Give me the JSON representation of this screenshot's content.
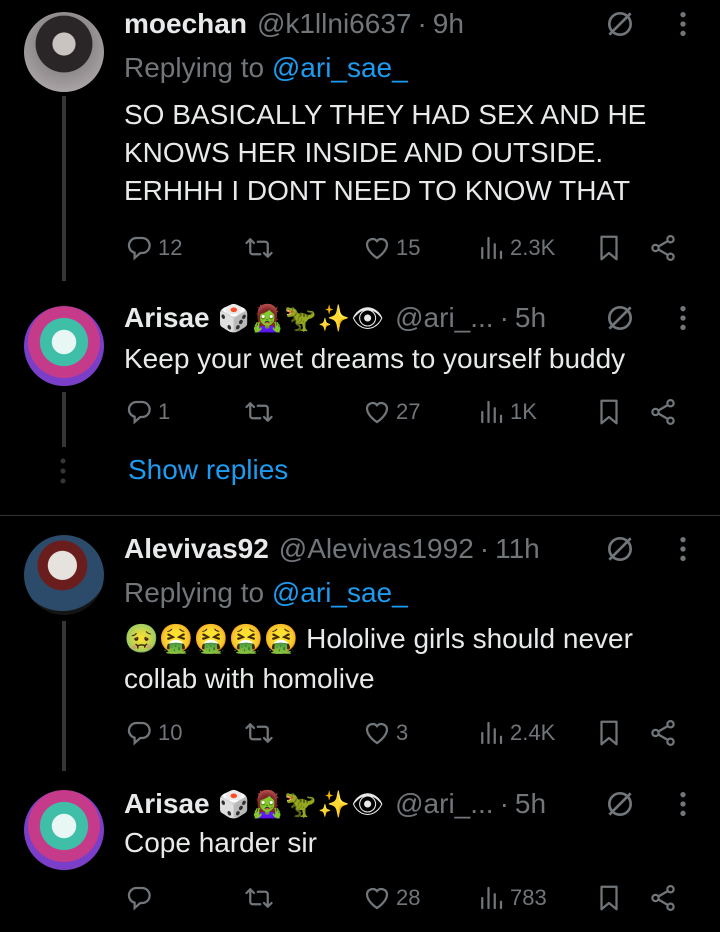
{
  "tweets": [
    {
      "name": "moechan",
      "emojis": "",
      "handle": "@k1llni6637",
      "time": "9h",
      "replying_prefix": "Replying to ",
      "replying_handle": "@ari_sae_",
      "text": "SO BASICALLY THEY HAD SEX AND HE KNOWS HER INSIDE AND OUTSIDE. ERHHH I DONT NEED TO KNOW THAT",
      "replies": "12",
      "retweets": "",
      "likes": "15",
      "views": "2.3K"
    },
    {
      "name": "Arisae",
      "emojis": "🎲🧟‍♀️🦖✨👁",
      "handle": "@ari_...",
      "time": "5h",
      "text": "Keep your wet dreams to yourself buddy",
      "replies": "1",
      "retweets": "",
      "likes": "27",
      "views": "1K"
    },
    {
      "name": "Alevivas92",
      "emojis": "",
      "handle": "@Alevivas1992",
      "time": "11h",
      "replying_prefix": "Replying to ",
      "replying_handle": "@ari_sae_",
      "text": "🤢🤮🤮🤮🤮 Hololive girls should never collab with homolive",
      "replies": "10",
      "retweets": "",
      "likes": "3",
      "views": "2.4K"
    },
    {
      "name": "Arisae",
      "emojis": "🎲🧟‍♀️🦖✨👁",
      "handle": "@ari_...",
      "time": "5h",
      "text": "Cope harder sir",
      "replies": "",
      "retweets": "",
      "likes": "28",
      "views": "783"
    }
  ],
  "show_replies": "Show replies",
  "colors": {
    "accent": "#1d9bf0",
    "muted": "#71767b",
    "text": "#e7e9ea",
    "bg": "#000000"
  },
  "icons": [
    "reply-icon",
    "retweet-icon",
    "like-icon",
    "views-icon",
    "bookmark-icon",
    "share-icon",
    "grok-icon",
    "more-icon"
  ]
}
